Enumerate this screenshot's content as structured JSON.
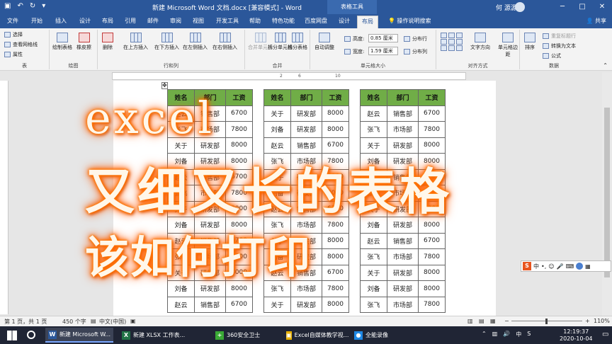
{
  "window": {
    "title": "新建 Microsoft Word 文档.docx [兼容模式] - Word",
    "context_tab": "表格工具",
    "user": "何 源源",
    "controls": [
      "─",
      "□",
      "✕"
    ]
  },
  "tabs": [
    "文件",
    "开始",
    "插入",
    "设计",
    "布局",
    "引用",
    "邮件",
    "审阅",
    "视图",
    "开发工具",
    "帮助",
    "特色功能",
    "百度网盘",
    "设计",
    "布局"
  ],
  "active_tab_index": 14,
  "help_search": "操作说明搜索",
  "share": "共享",
  "ribbon": {
    "groups": {
      "table": "表",
      "draw": "绘图",
      "rows_cols": "行和列",
      "merge": "合并",
      "cell_size": "单元格大小",
      "alignment": "对齐方式",
      "data": "数据"
    },
    "table": {
      "select": "选择",
      "gridlines": "查看网格线",
      "properties": "属性"
    },
    "draw": {
      "draw_table": "绘制表格",
      "eraser": "橡皮擦"
    },
    "rows_cols": {
      "delete": "删除",
      "insert_above": "在上方插入",
      "insert_below": "在下方插入",
      "insert_left": "在左侧插入",
      "insert_right": "在右侧插入"
    },
    "merge": {
      "merge_cells": "合并单元格",
      "split_cells": "拆分单元格",
      "split_table": "拆分表格"
    },
    "cell_size": {
      "autofit": "自动调整",
      "height_label": "高度:",
      "height_value": "0.85 厘米",
      "width_label": "宽度:",
      "width_value": "1.59 厘米",
      "distribute_rows": "分布行",
      "distribute_cols": "分布列"
    },
    "alignment": {
      "text_direction": "文字方向",
      "cell_margins": "单元格边距"
    },
    "data": {
      "sort": "排序",
      "repeat_header": "重复标题行",
      "convert_to_text": "转换为文本",
      "formula": "公式"
    }
  },
  "ruler": {
    "marks": [
      "2",
      "6",
      "10"
    ]
  },
  "tables": [
    {
      "headers": [
        "姓名",
        "部门",
        "工资"
      ],
      "rows": [
        [
          "赵云",
          "销售部",
          "6700"
        ],
        [
          "张飞",
          "市场部",
          "7800"
        ],
        [
          "关于",
          "研发部",
          "8000"
        ],
        [
          "刘备",
          "研发部",
          "8000"
        ],
        [
          "赵云",
          "销售部",
          "6700"
        ],
        [
          "张飞",
          "市场部",
          "7800"
        ],
        [
          "关于",
          "研发部",
          "8000"
        ],
        [
          "刘备",
          "研发部",
          "8000"
        ],
        [
          "赵云",
          "销售部",
          "6700"
        ],
        [
          "张飞",
          "市场部",
          "7800"
        ],
        [
          "关于",
          "研发部",
          "8000"
        ],
        [
          "刘备",
          "研发部",
          "8000"
        ],
        [
          "赵云",
          "销售部",
          "6700"
        ]
      ]
    },
    {
      "headers": [
        "姓名",
        "部门",
        "工资"
      ],
      "rows": [
        [
          "关于",
          "研发部",
          "8000"
        ],
        [
          "刘备",
          "研发部",
          "8000"
        ],
        [
          "赵云",
          "销售部",
          "6700"
        ],
        [
          "张飞",
          "市场部",
          "7800"
        ],
        [
          "关于",
          "研发部",
          "8000"
        ],
        [
          "刘备",
          "研发部",
          "8000"
        ],
        [
          "赵云",
          "销售部",
          "6700"
        ],
        [
          "张飞",
          "市场部",
          "7800"
        ],
        [
          "关于",
          "研发部",
          "8000"
        ],
        [
          "刘备",
          "研发部",
          "8000"
        ],
        [
          "赵云",
          "销售部",
          "6700"
        ],
        [
          "张飞",
          "市场部",
          "7800"
        ],
        [
          "关于",
          "研发部",
          "8000"
        ]
      ]
    },
    {
      "headers": [
        "姓名",
        "部门",
        "工资"
      ],
      "rows": [
        [
          "赵云",
          "销售部",
          "6700"
        ],
        [
          "张飞",
          "市场部",
          "7800"
        ],
        [
          "关于",
          "研发部",
          "8000"
        ],
        [
          "刘备",
          "研发部",
          "8000"
        ],
        [
          "赵云",
          "销售部",
          "6700"
        ],
        [
          "张飞",
          "市场部",
          "7800"
        ],
        [
          "关于",
          "研发部",
          "8000"
        ],
        [
          "刘备",
          "研发部",
          "8000"
        ],
        [
          "赵云",
          "销售部",
          "6700"
        ],
        [
          "张飞",
          "市场部",
          "7800"
        ],
        [
          "关于",
          "研发部",
          "8000"
        ],
        [
          "刘备",
          "研发部",
          "8000"
        ],
        [
          "张飞",
          "市场部",
          "7800"
        ]
      ]
    }
  ],
  "overlay": {
    "line1": "excel",
    "line2": "又细又长的表格",
    "line3": "该如何打印"
  },
  "ime": {
    "logo": "S",
    "mode": "中"
  },
  "statusbar": {
    "page": "第 1 页，共 1 页",
    "words": "450 个字",
    "language": "中文(中国)",
    "zoom": "110%"
  },
  "taskbar": {
    "apps": [
      {
        "label": "新建 Microsoft W...",
        "icon": "W",
        "color": "#2b579a",
        "active": true
      },
      {
        "label": "新建 XLSX 工作表...",
        "icon": "X",
        "color": "#217346",
        "active": false
      },
      {
        "label": "360安全卫士",
        "icon": "+",
        "color": "#3aa935",
        "active": false
      },
      {
        "label": "Excel自媒体教学视...",
        "icon": "▣",
        "color": "#e8b000",
        "active": false
      },
      {
        "label": "全能录像",
        "icon": "●",
        "color": "#1e88e5",
        "active": false
      }
    ],
    "time": "12:19:37",
    "date": "2020-10-04"
  },
  "colors": {
    "word_blue": "#2b579a",
    "header_green": "#70ad47",
    "glow_orange": "#ff7a00"
  }
}
